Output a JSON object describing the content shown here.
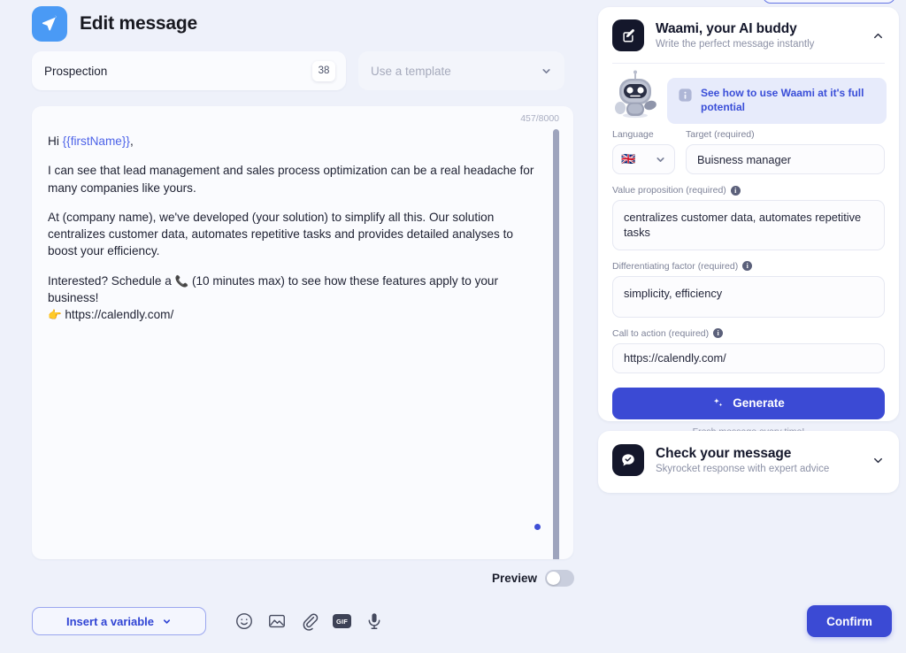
{
  "header": {
    "title": "Edit message",
    "logo_icon": "send-paper-plane-icon"
  },
  "toolbar_top": {
    "tag_label": "Prospection",
    "tag_count": "38",
    "template_placeholder": "Use a template",
    "template_chevron_icon": "chevron-down-icon"
  },
  "editor": {
    "char_counter": "457/8000",
    "greeting_prefix": "Hi ",
    "greeting_variable": "{{firstName}}",
    "greeting_suffix": ",",
    "paragraph_2": "I can see that lead management and sales process optimization can be a real headache for many companies like yours.",
    "paragraph_3": "At (company name), we've developed (your solution) to simplify all this. Our solution centralizes customer data, automates repetitive tasks and provides detailed analyses to boost your efficiency.",
    "paragraph_4_before": "Interested? Schedule a ",
    "paragraph_4_phone_emoji": "📞",
    "paragraph_4_after": " (10 minutes max) to see how these features apply to your business!",
    "paragraph_5_emoji": "👉",
    "paragraph_5_link": "https://calendly.com/"
  },
  "preview": {
    "label": "Preview",
    "enabled": false
  },
  "bottom_bar": {
    "insert_variable_label": "Insert a variable",
    "insert_variable_chevron_icon": "chevron-down-icon",
    "icons": [
      {
        "name": "emoji-icon",
        "label": "Emoji"
      },
      {
        "name": "image-icon",
        "label": "Image"
      },
      {
        "name": "attachment-paperclip-icon",
        "label": "Attachment"
      },
      {
        "name": "gif-icon",
        "label": "GIF"
      },
      {
        "name": "microphone-icon",
        "label": "Voice note"
      }
    ],
    "gif_label": "GIF",
    "confirm_label": "Confirm"
  },
  "waami_card": {
    "badge_icon": "edit-square-icon",
    "title": "Waami, your AI buddy",
    "subtitle": "Write the perfect message instantly",
    "collapse_icon": "chevron-up-icon",
    "mascot_icon": "robot-mascot-icon",
    "banner_icon": "information-icon",
    "banner_text": "See how to use Waami at it's full potential",
    "language_label": "Language",
    "language_flag": "🇬🇧",
    "language_chevron_icon": "chevron-down-icon",
    "target_label": "Target (required)",
    "target_value": "Buisness manager",
    "value_prop_label": "Value proposition (required)",
    "value_prop_info_icon": "info-tooltip-icon",
    "value_prop_value": "centralizes customer data, automates repetitive tasks",
    "diff_label": "Differentiating factor (required)",
    "diff_info_icon": "info-tooltip-icon",
    "diff_value": "simplicity, efficiency",
    "cta_label": "Call to action (required)",
    "cta_info_icon": "info-tooltip-icon",
    "cta_value": "https://calendly.com/",
    "generate_label": "Generate",
    "generate_icon": "sparkles-icon",
    "generate_hint": "Fresh message every time!",
    "info_glyph": "i"
  },
  "check_card": {
    "badge_icon": "chat-check-icon",
    "title": "Check your message",
    "subtitle": "Skyrocket response with expert advice",
    "expand_icon": "chevron-down-icon"
  },
  "colors": {
    "accent_blue": "#3b4ad4",
    "logo_blue": "#4a9af5",
    "page_bg": "#eef1fa",
    "badge_dark": "#14172b"
  }
}
